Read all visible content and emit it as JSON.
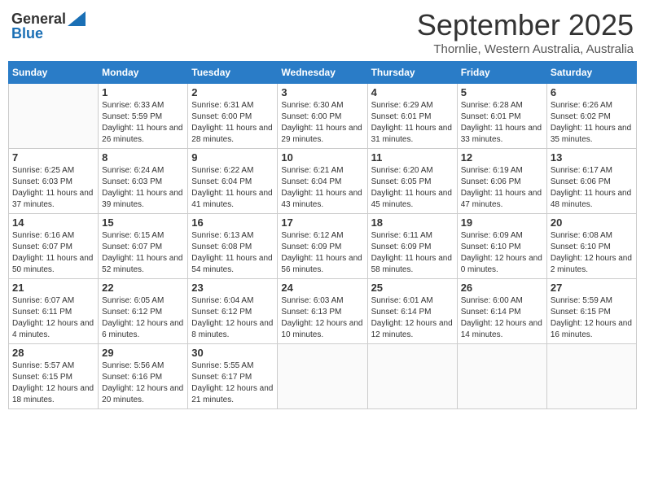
{
  "logo": {
    "general": "General",
    "blue": "Blue"
  },
  "title": "September 2025",
  "subtitle": "Thornlie, Western Australia, Australia",
  "days_of_week": [
    "Sunday",
    "Monday",
    "Tuesday",
    "Wednesday",
    "Thursday",
    "Friday",
    "Saturday"
  ],
  "weeks": [
    [
      {
        "day": "",
        "sunrise": "",
        "sunset": "",
        "daylight": ""
      },
      {
        "day": "1",
        "sunrise": "Sunrise: 6:33 AM",
        "sunset": "Sunset: 5:59 PM",
        "daylight": "Daylight: 11 hours and 26 minutes."
      },
      {
        "day": "2",
        "sunrise": "Sunrise: 6:31 AM",
        "sunset": "Sunset: 6:00 PM",
        "daylight": "Daylight: 11 hours and 28 minutes."
      },
      {
        "day": "3",
        "sunrise": "Sunrise: 6:30 AM",
        "sunset": "Sunset: 6:00 PM",
        "daylight": "Daylight: 11 hours and 29 minutes."
      },
      {
        "day": "4",
        "sunrise": "Sunrise: 6:29 AM",
        "sunset": "Sunset: 6:01 PM",
        "daylight": "Daylight: 11 hours and 31 minutes."
      },
      {
        "day": "5",
        "sunrise": "Sunrise: 6:28 AM",
        "sunset": "Sunset: 6:01 PM",
        "daylight": "Daylight: 11 hours and 33 minutes."
      },
      {
        "day": "6",
        "sunrise": "Sunrise: 6:26 AM",
        "sunset": "Sunset: 6:02 PM",
        "daylight": "Daylight: 11 hours and 35 minutes."
      }
    ],
    [
      {
        "day": "7",
        "sunrise": "Sunrise: 6:25 AM",
        "sunset": "Sunset: 6:03 PM",
        "daylight": "Daylight: 11 hours and 37 minutes."
      },
      {
        "day": "8",
        "sunrise": "Sunrise: 6:24 AM",
        "sunset": "Sunset: 6:03 PM",
        "daylight": "Daylight: 11 hours and 39 minutes."
      },
      {
        "day": "9",
        "sunrise": "Sunrise: 6:22 AM",
        "sunset": "Sunset: 6:04 PM",
        "daylight": "Daylight: 11 hours and 41 minutes."
      },
      {
        "day": "10",
        "sunrise": "Sunrise: 6:21 AM",
        "sunset": "Sunset: 6:04 PM",
        "daylight": "Daylight: 11 hours and 43 minutes."
      },
      {
        "day": "11",
        "sunrise": "Sunrise: 6:20 AM",
        "sunset": "Sunset: 6:05 PM",
        "daylight": "Daylight: 11 hours and 45 minutes."
      },
      {
        "day": "12",
        "sunrise": "Sunrise: 6:19 AM",
        "sunset": "Sunset: 6:06 PM",
        "daylight": "Daylight: 11 hours and 47 minutes."
      },
      {
        "day": "13",
        "sunrise": "Sunrise: 6:17 AM",
        "sunset": "Sunset: 6:06 PM",
        "daylight": "Daylight: 11 hours and 48 minutes."
      }
    ],
    [
      {
        "day": "14",
        "sunrise": "Sunrise: 6:16 AM",
        "sunset": "Sunset: 6:07 PM",
        "daylight": "Daylight: 11 hours and 50 minutes."
      },
      {
        "day": "15",
        "sunrise": "Sunrise: 6:15 AM",
        "sunset": "Sunset: 6:07 PM",
        "daylight": "Daylight: 11 hours and 52 minutes."
      },
      {
        "day": "16",
        "sunrise": "Sunrise: 6:13 AM",
        "sunset": "Sunset: 6:08 PM",
        "daylight": "Daylight: 11 hours and 54 minutes."
      },
      {
        "day": "17",
        "sunrise": "Sunrise: 6:12 AM",
        "sunset": "Sunset: 6:09 PM",
        "daylight": "Daylight: 11 hours and 56 minutes."
      },
      {
        "day": "18",
        "sunrise": "Sunrise: 6:11 AM",
        "sunset": "Sunset: 6:09 PM",
        "daylight": "Daylight: 11 hours and 58 minutes."
      },
      {
        "day": "19",
        "sunrise": "Sunrise: 6:09 AM",
        "sunset": "Sunset: 6:10 PM",
        "daylight": "Daylight: 12 hours and 0 minutes."
      },
      {
        "day": "20",
        "sunrise": "Sunrise: 6:08 AM",
        "sunset": "Sunset: 6:10 PM",
        "daylight": "Daylight: 12 hours and 2 minutes."
      }
    ],
    [
      {
        "day": "21",
        "sunrise": "Sunrise: 6:07 AM",
        "sunset": "Sunset: 6:11 PM",
        "daylight": "Daylight: 12 hours and 4 minutes."
      },
      {
        "day": "22",
        "sunrise": "Sunrise: 6:05 AM",
        "sunset": "Sunset: 6:12 PM",
        "daylight": "Daylight: 12 hours and 6 minutes."
      },
      {
        "day": "23",
        "sunrise": "Sunrise: 6:04 AM",
        "sunset": "Sunset: 6:12 PM",
        "daylight": "Daylight: 12 hours and 8 minutes."
      },
      {
        "day": "24",
        "sunrise": "Sunrise: 6:03 AM",
        "sunset": "Sunset: 6:13 PM",
        "daylight": "Daylight: 12 hours and 10 minutes."
      },
      {
        "day": "25",
        "sunrise": "Sunrise: 6:01 AM",
        "sunset": "Sunset: 6:14 PM",
        "daylight": "Daylight: 12 hours and 12 minutes."
      },
      {
        "day": "26",
        "sunrise": "Sunrise: 6:00 AM",
        "sunset": "Sunset: 6:14 PM",
        "daylight": "Daylight: 12 hours and 14 minutes."
      },
      {
        "day": "27",
        "sunrise": "Sunrise: 5:59 AM",
        "sunset": "Sunset: 6:15 PM",
        "daylight": "Daylight: 12 hours and 16 minutes."
      }
    ],
    [
      {
        "day": "28",
        "sunrise": "Sunrise: 5:57 AM",
        "sunset": "Sunset: 6:15 PM",
        "daylight": "Daylight: 12 hours and 18 minutes."
      },
      {
        "day": "29",
        "sunrise": "Sunrise: 5:56 AM",
        "sunset": "Sunset: 6:16 PM",
        "daylight": "Daylight: 12 hours and 20 minutes."
      },
      {
        "day": "30",
        "sunrise": "Sunrise: 5:55 AM",
        "sunset": "Sunset: 6:17 PM",
        "daylight": "Daylight: 12 hours and 21 minutes."
      },
      {
        "day": "",
        "sunrise": "",
        "sunset": "",
        "daylight": ""
      },
      {
        "day": "",
        "sunrise": "",
        "sunset": "",
        "daylight": ""
      },
      {
        "day": "",
        "sunrise": "",
        "sunset": "",
        "daylight": ""
      },
      {
        "day": "",
        "sunrise": "",
        "sunset": "",
        "daylight": ""
      }
    ]
  ]
}
